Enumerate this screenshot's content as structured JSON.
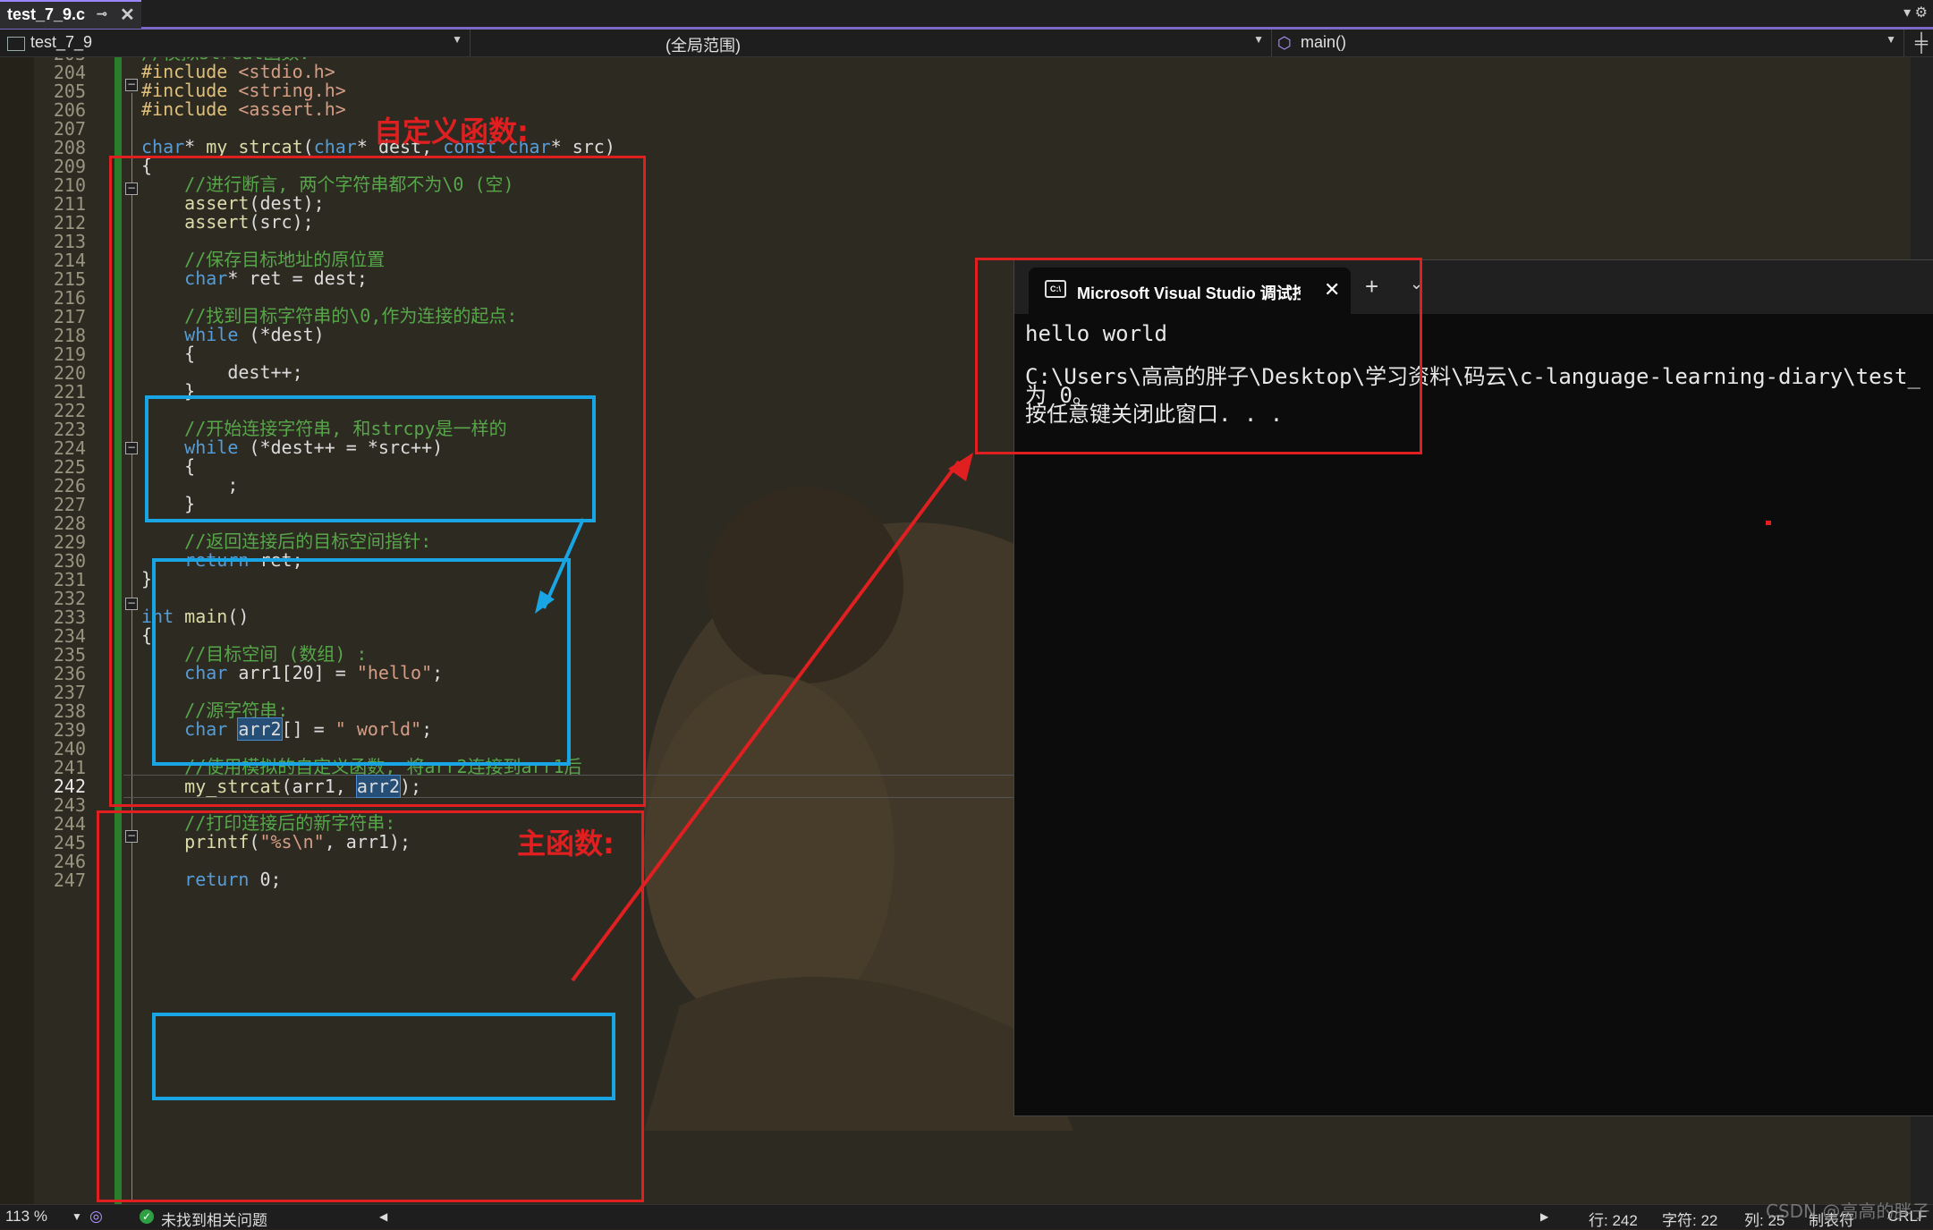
{
  "tabbar": {
    "file_tab": "test_7_9.c",
    "pin": "⊸",
    "close": "✕",
    "right_icons": "▾ ⚙"
  },
  "navbar": {
    "project": "test_7_9",
    "scope": "(全局范围)",
    "function": "main()",
    "split": "╪"
  },
  "editor": {
    "lines": [
      {
        "n": "203",
        "segs": [
          {
            "c": "cmt",
            "t": "//模拟strcat函数:"
          }
        ]
      },
      {
        "n": "204",
        "segs": [
          {
            "c": "inc",
            "t": "#include"
          },
          {
            "c": "",
            "t": " "
          },
          {
            "c": "str",
            "t": "<stdio.h>"
          }
        ]
      },
      {
        "n": "205",
        "segs": [
          {
            "c": "inc",
            "t": "#include"
          },
          {
            "c": "",
            "t": " "
          },
          {
            "c": "str",
            "t": "<string.h>"
          }
        ]
      },
      {
        "n": "206",
        "segs": [
          {
            "c": "inc",
            "t": "#include"
          },
          {
            "c": "",
            "t": " "
          },
          {
            "c": "str",
            "t": "<assert.h>"
          }
        ]
      },
      {
        "n": "207",
        "segs": []
      },
      {
        "n": "208",
        "segs": [
          {
            "c": "kw",
            "t": "char"
          },
          {
            "c": "",
            "t": "* "
          },
          {
            "c": "fn",
            "t": "my_strcat"
          },
          {
            "c": "",
            "t": "("
          },
          {
            "c": "kw",
            "t": "char"
          },
          {
            "c": "",
            "t": "* dest, "
          },
          {
            "c": "kw",
            "t": "const"
          },
          {
            "c": "",
            "t": " "
          },
          {
            "c": "kw",
            "t": "char"
          },
          {
            "c": "",
            "t": "* src)"
          }
        ]
      },
      {
        "n": "209",
        "segs": [
          {
            "c": "",
            "t": "{"
          }
        ]
      },
      {
        "n": "210",
        "segs": [
          {
            "c": "",
            "t": "    "
          },
          {
            "c": "cmt",
            "t": "//进行断言, 两个字符串都不为\\0 (空)"
          }
        ]
      },
      {
        "n": "211",
        "segs": [
          {
            "c": "",
            "t": "    "
          },
          {
            "c": "fn",
            "t": "assert"
          },
          {
            "c": "",
            "t": "(dest);"
          }
        ]
      },
      {
        "n": "212",
        "segs": [
          {
            "c": "",
            "t": "    "
          },
          {
            "c": "fn",
            "t": "assert"
          },
          {
            "c": "",
            "t": "(src);"
          }
        ]
      },
      {
        "n": "213",
        "segs": []
      },
      {
        "n": "214",
        "segs": [
          {
            "c": "",
            "t": "    "
          },
          {
            "c": "cmt",
            "t": "//保存目标地址的原位置"
          }
        ]
      },
      {
        "n": "215",
        "segs": [
          {
            "c": "",
            "t": "    "
          },
          {
            "c": "kw",
            "t": "char"
          },
          {
            "c": "",
            "t": "* ret = dest;"
          }
        ]
      },
      {
        "n": "216",
        "segs": []
      },
      {
        "n": "217",
        "segs": [
          {
            "c": "",
            "t": "    "
          },
          {
            "c": "cmt",
            "t": "//找到目标字符串的\\0,作为连接的起点:"
          }
        ]
      },
      {
        "n": "218",
        "segs": [
          {
            "c": "",
            "t": "    "
          },
          {
            "c": "kw",
            "t": "while"
          },
          {
            "c": "",
            "t": " (*dest)"
          }
        ]
      },
      {
        "n": "219",
        "segs": [
          {
            "c": "",
            "t": "    {"
          }
        ]
      },
      {
        "n": "220",
        "segs": [
          {
            "c": "",
            "t": "        dest++;"
          }
        ]
      },
      {
        "n": "221",
        "segs": [
          {
            "c": "",
            "t": "    }"
          }
        ]
      },
      {
        "n": "222",
        "segs": []
      },
      {
        "n": "223",
        "segs": [
          {
            "c": "",
            "t": "    "
          },
          {
            "c": "cmt",
            "t": "//开始连接字符串, 和strcpy是一样的"
          }
        ]
      },
      {
        "n": "224",
        "segs": [
          {
            "c": "",
            "t": "    "
          },
          {
            "c": "kw",
            "t": "while"
          },
          {
            "c": "",
            "t": " (*dest++ = *src++)"
          }
        ]
      },
      {
        "n": "225",
        "segs": [
          {
            "c": "",
            "t": "    {"
          }
        ]
      },
      {
        "n": "226",
        "segs": [
          {
            "c": "",
            "t": "        ;"
          }
        ]
      },
      {
        "n": "227",
        "segs": [
          {
            "c": "",
            "t": "    }"
          }
        ]
      },
      {
        "n": "228",
        "segs": []
      },
      {
        "n": "229",
        "segs": [
          {
            "c": "",
            "t": "    "
          },
          {
            "c": "cmt",
            "t": "//返回连接后的目标空间指针:"
          }
        ]
      },
      {
        "n": "230",
        "segs": [
          {
            "c": "",
            "t": "    "
          },
          {
            "c": "kw",
            "t": "return"
          },
          {
            "c": "",
            "t": " ret;"
          }
        ]
      },
      {
        "n": "231",
        "segs": [
          {
            "c": "",
            "t": "}"
          }
        ]
      },
      {
        "n": "232",
        "segs": []
      },
      {
        "n": "233",
        "segs": [
          {
            "c": "kw",
            "t": "int"
          },
          {
            "c": "",
            "t": " "
          },
          {
            "c": "fn",
            "t": "main"
          },
          {
            "c": "",
            "t": "()"
          }
        ]
      },
      {
        "n": "234",
        "segs": [
          {
            "c": "",
            "t": "{"
          }
        ]
      },
      {
        "n": "235",
        "segs": [
          {
            "c": "",
            "t": "    "
          },
          {
            "c": "cmt",
            "t": "//目标空间 (数组) :"
          }
        ]
      },
      {
        "n": "236",
        "segs": [
          {
            "c": "",
            "t": "    "
          },
          {
            "c": "kw",
            "t": "char"
          },
          {
            "c": "",
            "t": " arr1[20] = "
          },
          {
            "c": "str",
            "t": "\"hello\""
          },
          {
            "c": "",
            "t": ";"
          }
        ]
      },
      {
        "n": "237",
        "segs": []
      },
      {
        "n": "238",
        "segs": [
          {
            "c": "",
            "t": "    "
          },
          {
            "c": "cmt",
            "t": "//源字符串:"
          }
        ]
      },
      {
        "n": "239",
        "segs": [
          {
            "c": "",
            "t": "    "
          },
          {
            "c": "kw",
            "t": "char"
          },
          {
            "c": "",
            "t": " "
          },
          {
            "c": "hl",
            "t": "arr2"
          },
          {
            "c": "",
            "t": "[] = "
          },
          {
            "c": "str",
            "t": "\" world\""
          },
          {
            "c": "",
            "t": ";"
          }
        ]
      },
      {
        "n": "240",
        "segs": []
      },
      {
        "n": "241",
        "segs": [
          {
            "c": "",
            "t": "    "
          },
          {
            "c": "cmt",
            "t": "//使用模拟的自定义函数, 将arr2连接到arr1后"
          }
        ]
      },
      {
        "n": "242",
        "segs": [
          {
            "c": "",
            "t": "    "
          },
          {
            "c": "fn",
            "t": "my_strcat"
          },
          {
            "c": "",
            "t": "(arr1, "
          },
          {
            "c": "hl",
            "t": "arr2"
          },
          {
            "c": "",
            "t": ");"
          }
        ]
      },
      {
        "n": "243",
        "segs": []
      },
      {
        "n": "244",
        "segs": [
          {
            "c": "",
            "t": "    "
          },
          {
            "c": "cmt",
            "t": "//打印连接后的新字符串:"
          }
        ]
      },
      {
        "n": "245",
        "segs": [
          {
            "c": "",
            "t": "    "
          },
          {
            "c": "fn",
            "t": "printf"
          },
          {
            "c": "",
            "t": "("
          },
          {
            "c": "str",
            "t": "\"%s\\n\""
          },
          {
            "c": "",
            "t": ", arr1);"
          }
        ]
      },
      {
        "n": "246",
        "segs": []
      },
      {
        "n": "247",
        "segs": [
          {
            "c": "",
            "t": "    "
          },
          {
            "c": "kw",
            "t": "return"
          },
          {
            "c": "",
            "t": " 0;"
          }
        ]
      }
    ],
    "current_line": "242"
  },
  "annotations": {
    "custom_func": "自定义函数:",
    "main_func": "主函数:"
  },
  "console": {
    "tab_title": "Microsoft Visual Studio 调试控制台",
    "close": "✕",
    "plus": "+",
    "chevron": "⌄",
    "lines": [
      "hello world",
      "",
      "C:\\Users\\高高的胖子\\Desktop\\学习资料\\码云\\c-language-learning-diary\\test_",
      "为 0。",
      "按任意键关闭此窗口. . ."
    ]
  },
  "statusbar": {
    "zoom": "113 %",
    "issues": "未找到相关问题",
    "line": "行: 242",
    "char": "字符: 22",
    "col": "列: 25",
    "tabs": "制表符",
    "eol": "CRLF"
  },
  "watermark": "CSDN @高高的胖子",
  "colors": {
    "accent": "#7b68c8",
    "annotation_red": "#e02020",
    "annotation_blue": "#19a4e3",
    "change_bar": "#2a7d2a"
  }
}
